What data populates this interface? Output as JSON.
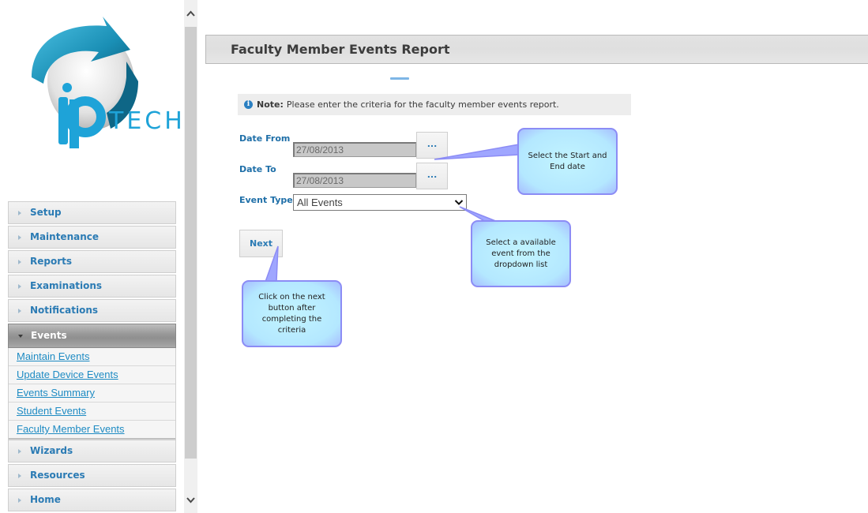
{
  "logo": {
    "text": "TECH",
    "brand_color": "#1ea3d8"
  },
  "sidebar": {
    "menu": [
      {
        "label": "Setup",
        "expanded": false
      },
      {
        "label": "Maintenance",
        "expanded": false
      },
      {
        "label": "Reports",
        "expanded": false
      },
      {
        "label": "Examinations",
        "expanded": false
      },
      {
        "label": "Notifications",
        "expanded": false
      },
      {
        "label": "Events",
        "expanded": true
      },
      {
        "label": "Wizards",
        "expanded": false
      },
      {
        "label": "Resources",
        "expanded": false
      },
      {
        "label": "Home",
        "expanded": false
      }
    ],
    "events_submenu": [
      "Maintain Events",
      "Update Device Events",
      "Events Summary",
      "Student Events",
      "Faculty Member Events"
    ]
  },
  "scrollbar": {
    "up_icon": "chevron-up",
    "down_icon": "chevron-down"
  },
  "header": {
    "title": "Faculty Member Events Report"
  },
  "note": {
    "icon": "info-icon",
    "label": "Note:",
    "text": "Please enter the criteria for the faculty member events report."
  },
  "form": {
    "date_from_label": "Date From",
    "date_from_value": "27/08/2013",
    "date_to_label": "Date To",
    "date_to_value": "27/08/2013",
    "picker_label": "...",
    "event_type_label": "Event Type",
    "event_type_value": "All Events",
    "next_label": "Next"
  },
  "callouts": {
    "dates": "Select the Start and End date",
    "event": "Select a available event from the dropdown list",
    "next": "Click on the next button after completing the criteria",
    "fill_color": "#b8ecff",
    "border_color": "#8c8cf5"
  }
}
